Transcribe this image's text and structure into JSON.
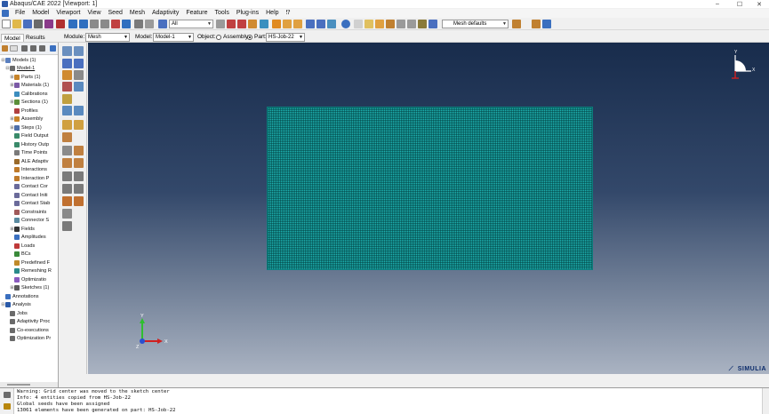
{
  "window": {
    "title": "Abaqus/CAE 2022 [Viewport: 1]",
    "controls": [
      "–",
      "☐",
      "✕"
    ]
  },
  "menu": [
    "File",
    "Model",
    "Viewport",
    "View",
    "Seed",
    "Mesh",
    "Adaptivity",
    "Feature",
    "Tools",
    "Plug-ins",
    "Help",
    "⁉"
  ],
  "toolbar": {
    "selection_filter": "All",
    "render_style": "Mesh defaults"
  },
  "context": {
    "tabs": [
      "Model",
      "Results"
    ],
    "active_tab": "Model",
    "module_label": "Module:",
    "module_value": "Mesh",
    "model_label": "Model:",
    "model_value": "Model-1",
    "object_label": "Object:",
    "assembly_label": "Assembly",
    "part_label": "Part:",
    "part_value": "HS-Job-22"
  },
  "tree": [
    {
      "label": "Models (1)",
      "depth": 0,
      "exp": "⊟",
      "icon": "models-icon",
      "color": "#5a7fbf"
    },
    {
      "label": "Model-1",
      "depth": 1,
      "exp": "⊟",
      "icon": "model-icon",
      "color": "#6a6a6a",
      "underline": true
    },
    {
      "label": "Parts (1)",
      "depth": 2,
      "exp": "⊞",
      "icon": "parts-icon",
      "color": "#c7842a"
    },
    {
      "label": "Materials (1)",
      "depth": 2,
      "exp": "⊞",
      "icon": "materials-icon",
      "color": "#7b5aa6"
    },
    {
      "label": "Calibrations",
      "depth": 2,
      "exp": "",
      "icon": "calibrations-icon",
      "color": "#3c8dbf"
    },
    {
      "label": "Sections (1)",
      "depth": 2,
      "exp": "⊞",
      "icon": "sections-icon",
      "color": "#5b8f3a"
    },
    {
      "label": "Profiles",
      "depth": 2,
      "exp": "",
      "icon": "profiles-icon",
      "color": "#b04040"
    },
    {
      "label": "Assembly",
      "depth": 2,
      "exp": "⊞",
      "icon": "assembly-icon",
      "color": "#c7842a"
    },
    {
      "label": "Steps (1)",
      "depth": 2,
      "exp": "⊞",
      "icon": "steps-icon",
      "color": "#4f6fa8"
    },
    {
      "label": "Field Output",
      "depth": 2,
      "exp": "",
      "icon": "field-output-icon",
      "color": "#3a8a6a"
    },
    {
      "label": "History Outp",
      "depth": 2,
      "exp": "",
      "icon": "history-output-icon",
      "color": "#3a8a6a"
    },
    {
      "label": "Time Points",
      "depth": 2,
      "exp": "",
      "icon": "time-points-icon",
      "color": "#7a7a7a"
    },
    {
      "label": "ALE Adaptiv",
      "depth": 2,
      "exp": "",
      "icon": "ale-adaptive-icon",
      "color": "#9a6a2a"
    },
    {
      "label": "Interactions",
      "depth": 2,
      "exp": "",
      "icon": "interactions-icon",
      "color": "#bf7a2a"
    },
    {
      "label": "Interaction P",
      "depth": 2,
      "exp": "",
      "icon": "interaction-properties-icon",
      "color": "#bf7a2a"
    },
    {
      "label": "Contact Cor",
      "depth": 2,
      "exp": "",
      "icon": "contact-controls-icon",
      "color": "#6a6a9a"
    },
    {
      "label": "Contact Initi",
      "depth": 2,
      "exp": "",
      "icon": "contact-init-icon",
      "color": "#6a6a9a"
    },
    {
      "label": "Contact Stab",
      "depth": 2,
      "exp": "",
      "icon": "contact-stab-icon",
      "color": "#6a6a9a"
    },
    {
      "label": "Constraints",
      "depth": 2,
      "exp": "",
      "icon": "constraints-icon",
      "color": "#a05a5a"
    },
    {
      "label": "Connector S",
      "depth": 2,
      "exp": "",
      "icon": "connector-icon",
      "color": "#5a8aa0"
    },
    {
      "label": "Fields",
      "depth": 2,
      "exp": "⊞",
      "icon": "fields-icon",
      "color": "#333333"
    },
    {
      "label": "Amplitudes",
      "depth": 2,
      "exp": "",
      "icon": "amplitudes-icon",
      "color": "#3a6fbf"
    },
    {
      "label": "Loads",
      "depth": 2,
      "exp": "",
      "icon": "loads-icon",
      "color": "#bf3a3a"
    },
    {
      "label": "BCs",
      "depth": 2,
      "exp": "",
      "icon": "bcs-icon",
      "color": "#3a8a3a"
    },
    {
      "label": "Predefined F",
      "depth": 2,
      "exp": "",
      "icon": "predefined-fields-icon",
      "color": "#bf8a2a"
    },
    {
      "label": "Remeshing R",
      "depth": 2,
      "exp": "",
      "icon": "remeshing-icon",
      "color": "#2a8a8a"
    },
    {
      "label": "Optimizatio",
      "depth": 2,
      "exp": "",
      "icon": "optimization-icon",
      "color": "#8a5abf"
    },
    {
      "label": "Sketches (1)",
      "depth": 2,
      "exp": "⊞",
      "icon": "sketches-icon",
      "color": "#5a5a5a"
    },
    {
      "label": "Annotations",
      "depth": 0,
      "exp": "",
      "icon": "annotations-icon",
      "color": "#3a6fbf"
    },
    {
      "label": "Analysis",
      "depth": 0,
      "exp": "⊟",
      "icon": "analysis-icon",
      "color": "#2a5aa8"
    },
    {
      "label": "Jobs",
      "depth": 1,
      "exp": "",
      "icon": "jobs-icon",
      "color": "#6a6a6a"
    },
    {
      "label": "Adaptivity Proc",
      "depth": 1,
      "exp": "",
      "icon": "adaptivity-process-icon",
      "color": "#6a6a6a"
    },
    {
      "label": "Co-executions",
      "depth": 1,
      "exp": "",
      "icon": "co-executions-icon",
      "color": "#6a6a6a"
    },
    {
      "label": "Optimization Pr",
      "depth": 1,
      "exp": "",
      "icon": "optimization-process-icon",
      "color": "#6a6a6a"
    }
  ],
  "triad": {
    "x": "X",
    "y": "Y",
    "z": "Z"
  },
  "brand": "SIMULIA",
  "messages": [
    "Warning: Grid center was moved to the sketch center",
    "Info: 4 entities copied from HS-Job-22",
    "Global seeds have been assigned",
    "13061 elements have been generated on part: HS-Job-22"
  ]
}
